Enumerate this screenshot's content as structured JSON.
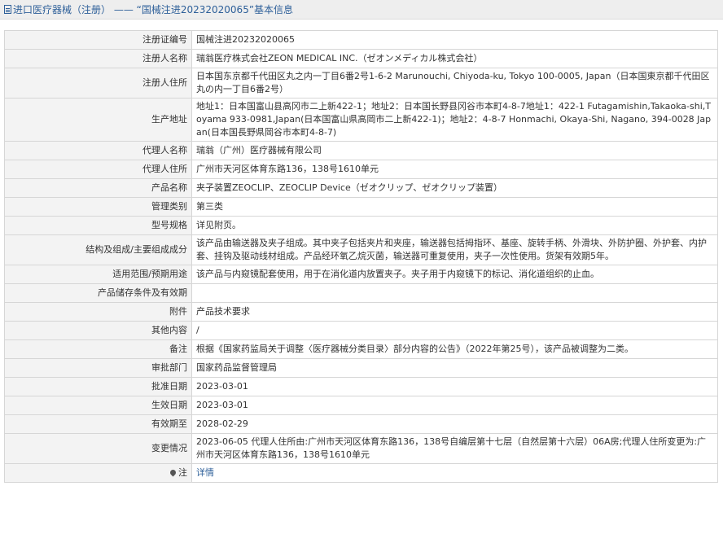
{
  "header": {
    "title": "进口医疗器械（注册） —— “国械注进20232020065”基本信息"
  },
  "rows": [
    {
      "label": "注册证编号",
      "value": "国械注进20232020065"
    },
    {
      "label": "注册人名称",
      "value": "瑞翁医疗株式会社ZEON MEDICAL INC.（ゼオンメディカル株式会社）"
    },
    {
      "label": "注册人住所",
      "value": "日本国东京都千代田区丸之内一丁目6番2号1-6-2 Marunouchi, Chiyoda-ku, Tokyo 100-0005, Japan（日本国東京都千代田区丸の内一丁目6番2号）"
    },
    {
      "label": "生产地址",
      "value": "地址1：日本国富山县高冈市二上新422-1；地址2：日本国长野县冈谷市本町4-8-7地址1：422-1 Futagamishin,Takaoka-shi,Toyama 933-0981,Japan(日本国富山県高岡市二上新422-1)；地址2：4-8-7 Honmachi, Okaya-Shi, Nagano, 394-0028 Japan(日本国長野県岡谷市本町4-8-7)"
    },
    {
      "label": "代理人名称",
      "value": "瑞翁（广州）医疗器械有限公司"
    },
    {
      "label": "代理人住所",
      "value": "广州市天河区体育东路136，138号1610单元"
    },
    {
      "label": "产品名称",
      "value": "夹子装置ZEOCLIP、ZEOCLIP Device（ゼオクリップ、ゼオクリップ装置）"
    },
    {
      "label": "管理类别",
      "value": "第三类"
    },
    {
      "label": "型号规格",
      "value": "详见附页。"
    },
    {
      "label": "结构及组成/主要组成成分",
      "value": "该产品由输送器及夹子组成。其中夹子包括夹片和夹座，输送器包括拇指环、基座、旋转手柄、外滑块、外防护圈、外护套、内护套、挂钩及驱动线材组成。产品经环氧乙烷灭菌，输送器可重复使用，夹子一次性使用。货架有效期5年。"
    },
    {
      "label": "适用范围/预期用途",
      "value": "该产品与内窥镜配套使用，用于在消化道内放置夹子。夹子用于内窥镜下的标记、消化道组织的止血。"
    },
    {
      "label": "产品储存条件及有效期",
      "value": ""
    },
    {
      "label": "附件",
      "value": "产品技术要求"
    },
    {
      "label": "其他内容",
      "value": "/"
    },
    {
      "label": "备注",
      "value": "根据《国家药监局关于调整〈医疗器械分类目录〉部分内容的公告》（2022年第25号），该产品被调整为二类。"
    },
    {
      "label": "审批部门",
      "value": "国家药品监督管理局"
    },
    {
      "label": "批准日期",
      "value": "2023-03-01"
    },
    {
      "label": "生效日期",
      "value": "2023-03-01"
    },
    {
      "label": "有效期至",
      "value": "2028-02-29"
    },
    {
      "label": "变更情况",
      "value": "2023-06-05 代理人住所由:广州市天河区体育东路136，138号自编层第十七层（自然层第十六层）06A房;代理人住所变更为:广州市天河区体育东路136，138号1610单元"
    }
  ],
  "note": {
    "label": "注",
    "icon": "pin-icon",
    "link_text": "详情",
    "link_color": "#2d5f99"
  }
}
